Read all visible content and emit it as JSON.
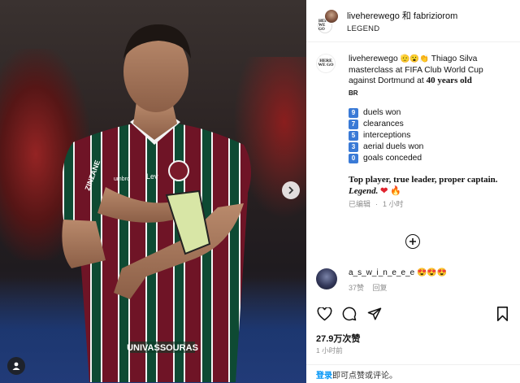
{
  "header": {
    "users": "liveherewego 和 fabriziorom",
    "audio": "LEGEND"
  },
  "account_logo_text": "HERE WE GO",
  "caption": {
    "username": "liveherewego",
    "emojis": "🫡😮👏",
    "text_part1": "Thiago Silva masterclass at FIFA Club World Cup against Dortmund at ",
    "text_bold": "40 years old",
    "country": "BR",
    "stats": [
      {
        "num": "9",
        "label": "duels won"
      },
      {
        "num": "7",
        "label": "clearances"
      },
      {
        "num": "5",
        "label": "interceptions"
      },
      {
        "num": "3",
        "label": "aerial duels won"
      },
      {
        "num": "0",
        "label": "goals conceded"
      }
    ],
    "closing_text": "Top player, true leader, proper captain. ",
    "closing_italic": "Legend.",
    "closing_heart": "❤",
    "closing_fire": "🔥",
    "edited": "已编辑",
    "dot": "·",
    "edited_time": "1 小时"
  },
  "comment": {
    "username": "a_s_w_i_n_e_e_e",
    "emojis": "😍😍😍",
    "likes": "37赞",
    "reply": "回复"
  },
  "likes": "27.9万次赞",
  "timestamp": "1 小时前",
  "login_bar": {
    "link": "登录",
    "text": "即可点赞或评论。"
  },
  "colors": {
    "stat_badge": "#3a7ad6",
    "link_blue": "#0095f6",
    "jersey_maroon": "#7a1a2a",
    "jersey_green": "#0f5a3a"
  },
  "icons": [
    "next-arrow-icon",
    "tag-user-icon",
    "add-circle-icon",
    "heart-icon",
    "comment-icon",
    "share-icon",
    "bookmark-icon"
  ]
}
